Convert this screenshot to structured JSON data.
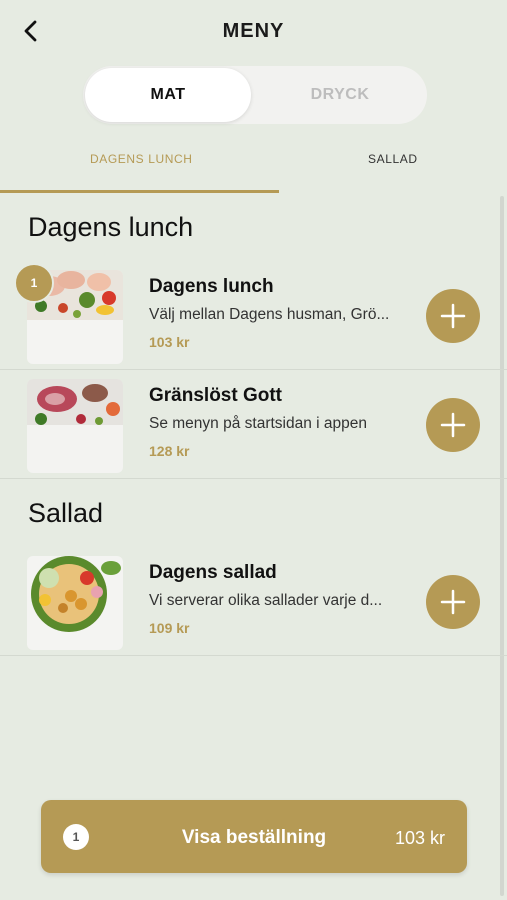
{
  "header": {
    "title": "MENY",
    "back_icon": "chevron-left-icon"
  },
  "segments": {
    "active": "MAT",
    "inactive": "DRYCK"
  },
  "tabs": [
    {
      "label": "DAGENS LUNCH",
      "selected": true
    },
    {
      "label": "SALLAD",
      "selected": false
    }
  ],
  "sections": [
    {
      "title": "Dagens lunch",
      "items": [
        {
          "name": "Dagens lunch",
          "description": "Välj mellan Dagens husman, Grö...",
          "price": "103 kr",
          "quantity": "1"
        },
        {
          "name": "Gränslöst Gott",
          "description": "Se menyn på startsidan i appen",
          "price": "128 kr"
        }
      ]
    },
    {
      "title": "Sallad",
      "items": [
        {
          "name": "Dagens sallad",
          "description": "Vi serverar olika sallader varje d...",
          "price": "109 kr"
        }
      ]
    }
  ],
  "order_bar": {
    "count": "1",
    "label": "Visa beställning",
    "total": "103 kr"
  },
  "colors": {
    "background": "#e6ebe2",
    "accent": "#b59a55",
    "text": "#111111",
    "muted": "#bdbdbd"
  }
}
